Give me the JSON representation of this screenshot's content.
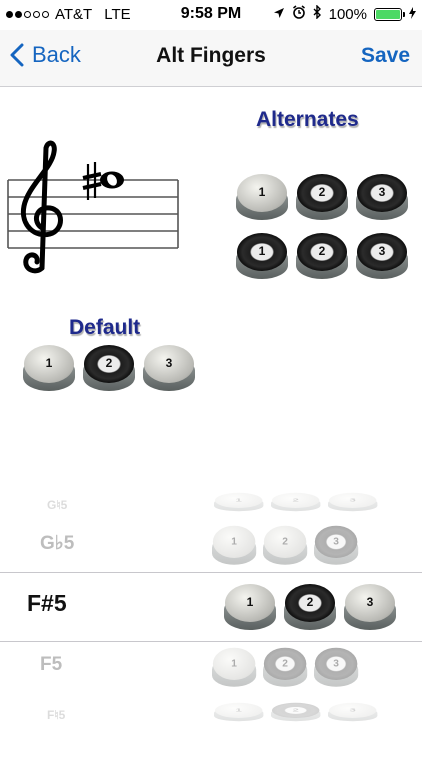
{
  "status_bar": {
    "carrier": "AT&T",
    "network": "LTE",
    "time": "9:58 PM",
    "battery": "100%",
    "signal_dots_filled": 2,
    "signal_dots_total": 5,
    "battery_level_fraction": 1.0
  },
  "nav": {
    "back_label": "Back",
    "title": "Alt Fingers",
    "save_label": "Save"
  },
  "alternates_heading": "Alternates",
  "default_heading": "Default",
  "valve_labels": [
    "1",
    "2",
    "3"
  ],
  "alternates": [
    [
      false,
      true,
      true
    ],
    [
      true,
      true,
      true
    ]
  ],
  "default": [
    false,
    true,
    false
  ],
  "notes_picker": [
    {
      "label": "G♮5",
      "valves": [
        false,
        false,
        false
      ]
    },
    {
      "label": "G♭5",
      "valves": [
        false,
        false,
        true
      ]
    },
    {
      "label": "F#5",
      "valves": [
        false,
        true,
        false
      ],
      "selected": true
    },
    {
      "label": "F5",
      "valves": [
        false,
        true,
        true
      ]
    },
    {
      "label": "F♮5",
      "valves": [
        false,
        true,
        false
      ]
    }
  ],
  "colors": {
    "accent": "#1565c0",
    "heading": "#1f2a8c",
    "battery": "#4cd964"
  }
}
